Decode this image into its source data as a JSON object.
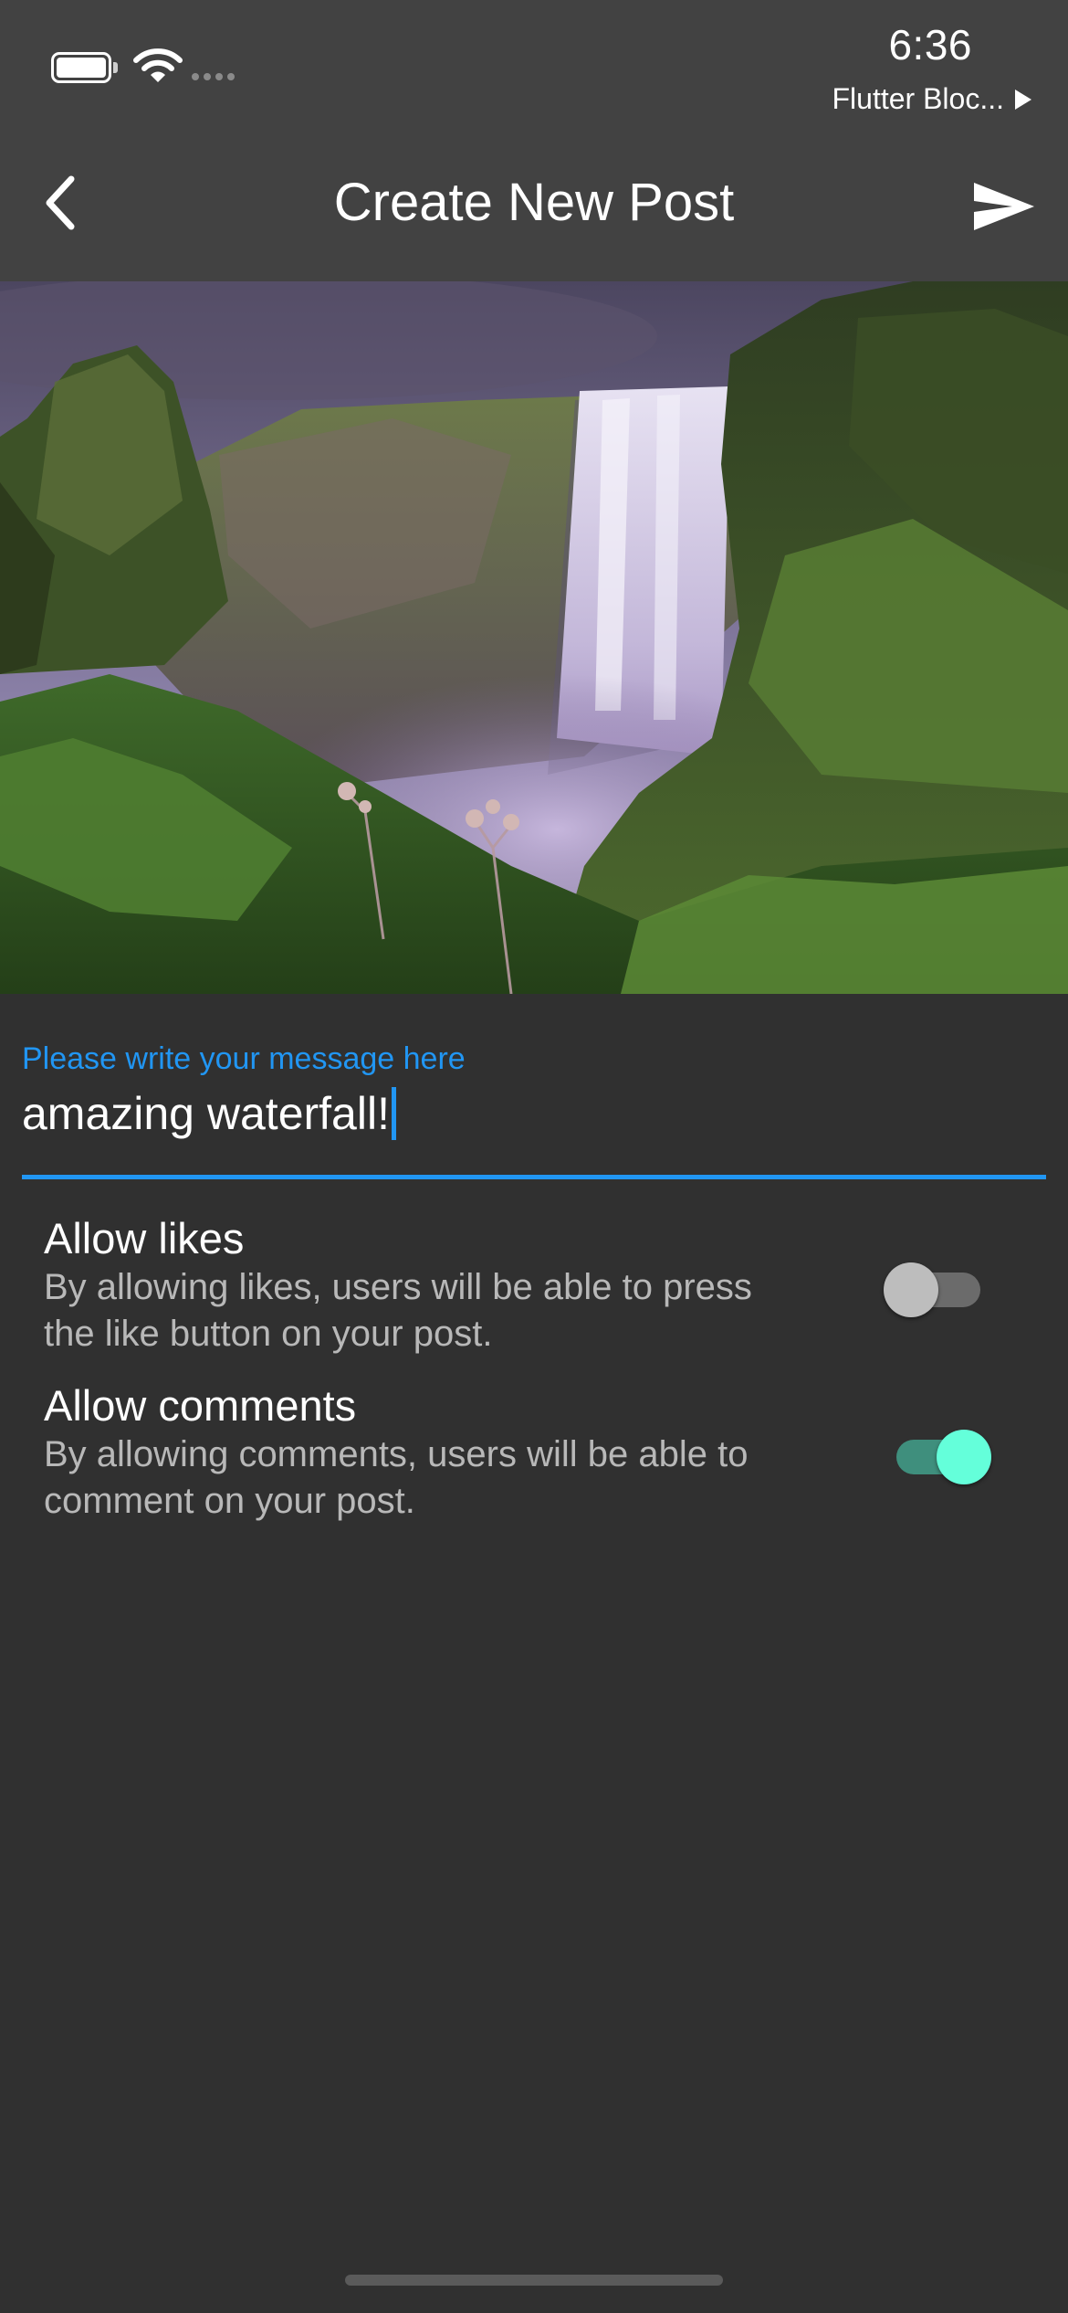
{
  "status_bar": {
    "time": "6:36",
    "carrier": "Flutter Bloc...",
    "icons": [
      "battery-icon",
      "wifi-icon",
      "signal-icon",
      "play-icon"
    ]
  },
  "app_bar": {
    "title": "Create New Post",
    "back_icon": "chevron-left-icon",
    "send_icon": "send-icon"
  },
  "post_image": {
    "subject": "waterfall photo"
  },
  "message_field": {
    "label": "Please write your message here",
    "value": "amazing waterfall!"
  },
  "settings": [
    {
      "title": "Allow likes",
      "subtitle": "By allowing likes, users will be able to press the like button on your post.",
      "enabled": false
    },
    {
      "title": "Allow comments",
      "subtitle": "By allowing comments, users will be able to comment on your post.",
      "enabled": true
    }
  ],
  "colors": {
    "background": "#303030",
    "app_bar": "#424242",
    "accent": "#2196f3",
    "switch_on_thumb": "#64ffda",
    "switch_on_track": "#3f8f7d",
    "switch_off_thumb": "#bdbdbd",
    "switch_off_track": "#6b6b6b",
    "subtitle_text": "#b8b8b8"
  }
}
